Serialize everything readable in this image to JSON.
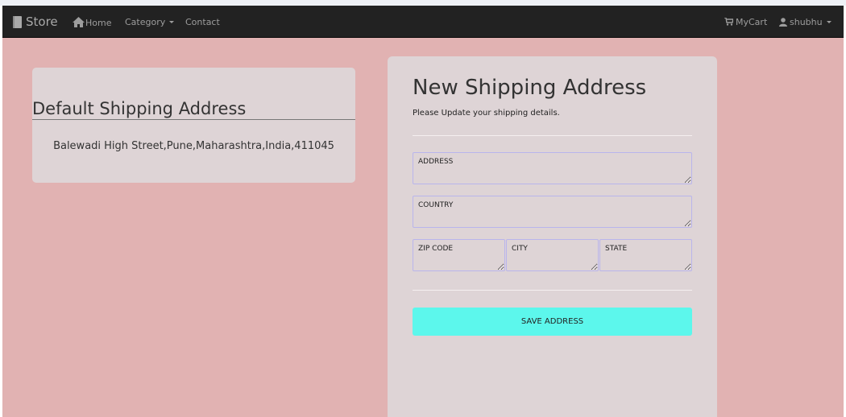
{
  "navbar": {
    "brand": "Store",
    "home": "Home",
    "category": "Category",
    "contact": "Contact",
    "cart": "MyCart",
    "user": "shubhu"
  },
  "default_address": {
    "title": "Default Shipping Address",
    "address": "Balewadi High Street,Pune,Maharashtra,India,411045"
  },
  "new_address": {
    "title": "New Shipping Address",
    "subtitle": "Please Update your shipping details.",
    "fields": {
      "address_placeholder": "ADDRESS",
      "country_placeholder": "COUNTRY",
      "zip_placeholder": "ZIP CODE",
      "city_placeholder": "CITY",
      "state_placeholder": "STATE"
    },
    "save_label": "SAVE ADDRESS"
  },
  "colors": {
    "navbar_bg": "#222222",
    "page_bg": "#e1b2b2",
    "card_bg": "#ded4d6",
    "save_button": "#5cf7ec",
    "field_border": "#b9b5ec"
  },
  "icons": {
    "brand": "book-icon",
    "home": "home-icon",
    "category": "caret-down-icon",
    "cart": "shopping-cart-icon",
    "user": "user-icon"
  }
}
